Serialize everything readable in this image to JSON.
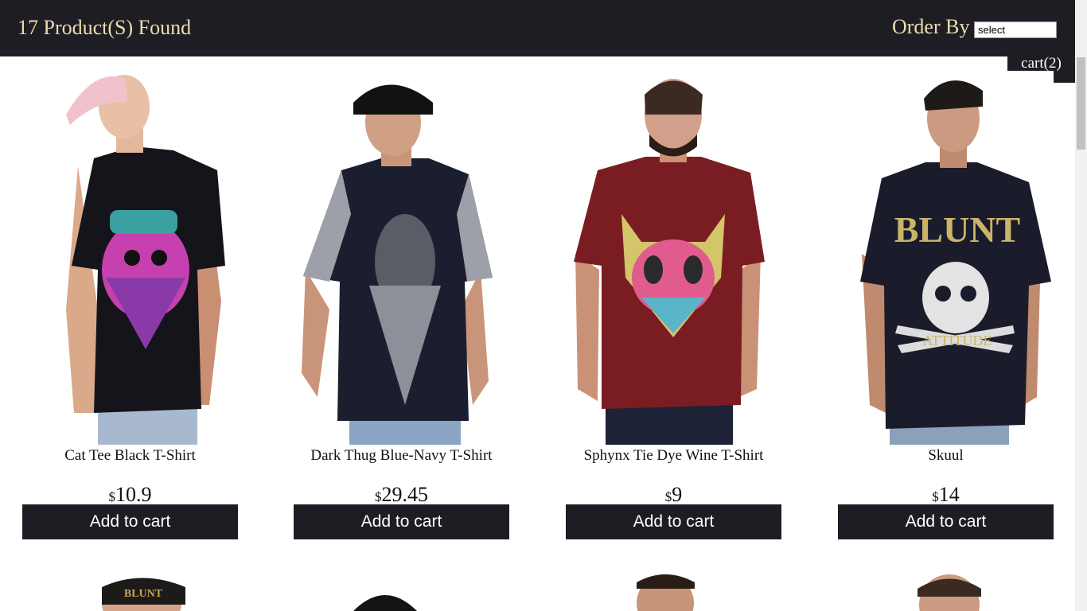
{
  "header": {
    "products_found": "17 Product(S) Found",
    "order_by_label": "Order By",
    "order_by_value": "select"
  },
  "cart": {
    "label": "cart(2)"
  },
  "products": [
    {
      "name": "Cat Tee Black T-Shirt",
      "currency": "$",
      "price": "10.9",
      "button": "Add to cart",
      "shirt_color": "#15141a",
      "print": "pink bearded cat graphic"
    },
    {
      "name": "Dark Thug Blue-Navy T-Shirt",
      "currency": "$",
      "price": "29.45",
      "button": "Add to cart",
      "shirt_color": "#1b1e2e",
      "print": "bandana paisley graphic"
    },
    {
      "name": "Sphynx Tie Dye Wine T-Shirt",
      "currency": "$",
      "price": "9",
      "button": "Add to cart",
      "shirt_color": "#7a1d22",
      "print": "tie dye cat graphic"
    },
    {
      "name": "Skuul",
      "currency": "$",
      "price": "14",
      "button": "Add to cart",
      "shirt_color": "#1a1c2b",
      "print": "skull BLUNT graphic"
    }
  ],
  "colors": {
    "header_bg": "#1f1d24",
    "header_text": "#ecdcb0",
    "button_bg": "#1f1d24",
    "button_text": "#ffffff"
  }
}
